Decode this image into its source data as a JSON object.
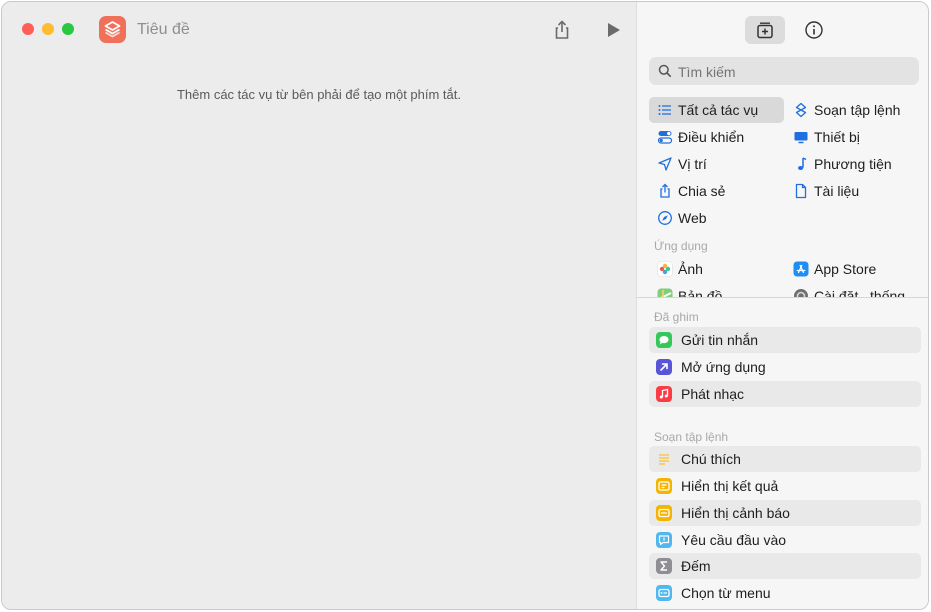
{
  "window": {
    "title": "Tiêu đề"
  },
  "editor": {
    "hint": "Thêm các tác vụ từ bên phải để tạo một phím tắt."
  },
  "search": {
    "placeholder": "Tìm kiếm"
  },
  "categories": [
    {
      "label": "Tất cả tác vụ",
      "icon": "list-icon",
      "selected": true
    },
    {
      "label": "Soạn tập lệnh",
      "icon": "scripting-icon"
    },
    {
      "label": "Điều khiển",
      "icon": "toggle-icon"
    },
    {
      "label": "Thiết bị",
      "icon": "display-icon"
    },
    {
      "label": "Vị trí",
      "icon": "location-arrow-icon"
    },
    {
      "label": "Phương tiện",
      "icon": "music-note-icon"
    },
    {
      "label": "Chia sẻ",
      "icon": "share-icon"
    },
    {
      "label": "Tài liệu",
      "icon": "document-icon"
    },
    {
      "label": "Web",
      "icon": "compass-icon"
    }
  ],
  "apps_section": {
    "heading": "Ứng dụng",
    "items": [
      {
        "label": "Ảnh",
        "icon": "photos-icon"
      },
      {
        "label": "App Store",
        "icon": "app-store-icon"
      },
      {
        "label": "Bản đồ",
        "icon": "maps-icon"
      },
      {
        "label": "Cài đặt...thống",
        "icon": "settings-gear-icon"
      }
    ]
  },
  "pinned": {
    "heading": "Đã ghim",
    "items": [
      {
        "label": "Gửi tin nhắn",
        "icon": "messages-icon",
        "color": "#34c759"
      },
      {
        "label": "Mở ứng dụng",
        "icon": "open-app-icon",
        "color": "#5856d6"
      },
      {
        "label": "Phát nhạc",
        "icon": "music-icon",
        "color": "#fc3c44"
      }
    ]
  },
  "scripting": {
    "heading": "Soạn tập lệnh",
    "items": [
      {
        "label": "Chú thích",
        "icon": "comment-lines-icon",
        "color": "#f5c84c"
      },
      {
        "label": "Hiển thị kết quả",
        "icon": "show-result-icon",
        "color": "#f5b400"
      },
      {
        "label": "Hiển thị cảnh báo",
        "icon": "alert-icon",
        "color": "#f5b400"
      },
      {
        "label": "Yêu cầu đầu vào",
        "icon": "ask-input-icon",
        "color": "#4fb8f0"
      },
      {
        "label": "Đếm",
        "icon": "sigma-icon",
        "color": "#8e8e93"
      },
      {
        "label": "Chọn từ menu",
        "icon": "menu-icon",
        "color": "#4fb8f0"
      }
    ]
  },
  "colors": {
    "accent": "#1f6fe0",
    "app_icon": "#f0705a"
  }
}
